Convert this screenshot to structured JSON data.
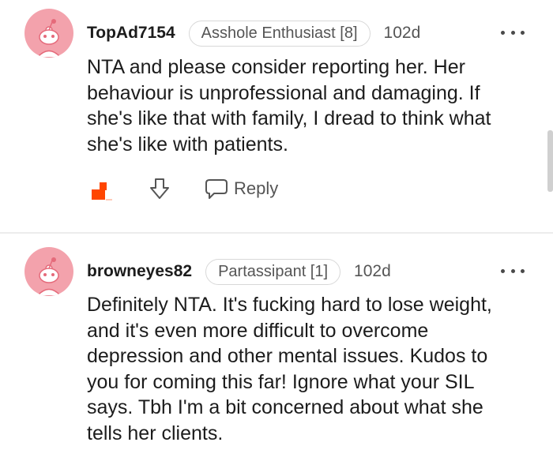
{
  "comments": [
    {
      "username": "TopAd7154",
      "flair": "Asshole Enthusiast [8]",
      "age": "102d",
      "lines": [
        "NTA and please consider reporting her. Her",
        "behaviour is unprofessional and damaging. If",
        "she's like that with family, I dread to think what",
        "she's like with patients."
      ],
      "reply_label": "Reply"
    },
    {
      "username": "browneyes82",
      "flair": "Partassipant [1]",
      "age": "102d",
      "lines": [
        "Definitely NTA. It's fucking hard to lose weight,",
        "and it's even more difficult to overcome",
        "depression and other mental issues. Kudos to",
        "you for coming this far! Ignore what your SIL",
        "says. Tbh I'm a bit concerned about what she",
        "tells her clients."
      ]
    }
  ],
  "icons": {
    "avatar": "snoo-avatar-icon",
    "more": "more-options-icon",
    "upvote": "upvote-icon",
    "downvote": "downvote-icon",
    "reply": "comment-bubble-icon"
  },
  "colors": {
    "avatar_bg": "#f3a2ac",
    "upvote_active": "#ff4500"
  }
}
